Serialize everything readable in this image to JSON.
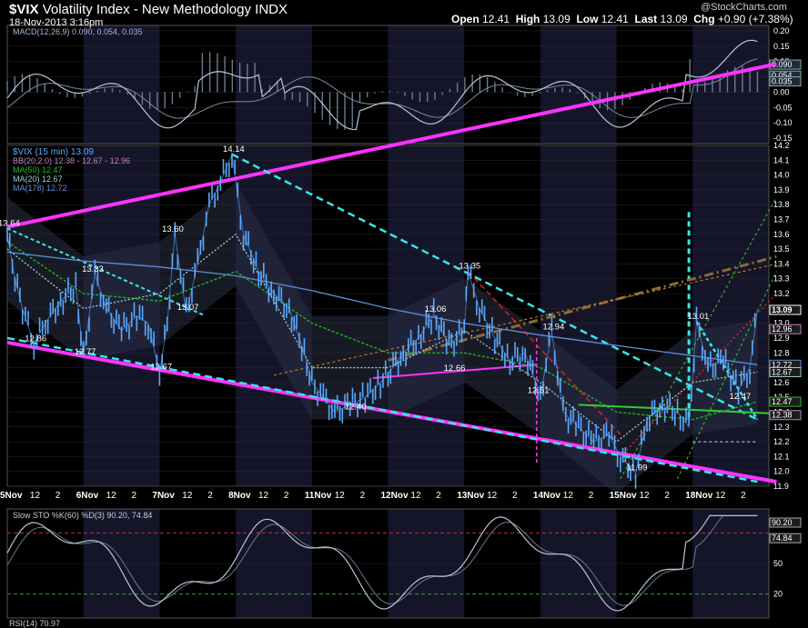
{
  "header": {
    "symbol": "$VIX",
    "name": "Volatility Index - New Methodology",
    "exchange": "INDX",
    "datetime": "18-Nov-2013 3:16pm",
    "open_label": "Open",
    "open": "12.41",
    "high_label": "High",
    "high": "13.09",
    "low_label": "Low",
    "low": "12.41",
    "last_label": "Last",
    "last": "13.09",
    "chg_label": "Chg",
    "chg": "+0.90 (+7.38%)",
    "watermark": "@StockCharts.com"
  },
  "colors": {
    "background": "#000000",
    "band": "#15152a",
    "price": "#5aa8ff",
    "magenta": "#ff33ff",
    "cyan": "#39e6e6",
    "ma50": "#1fbf1f",
    "ma20": "#9ad0d6",
    "ma178": "#5f8fd8",
    "red": "#e02020",
    "orange": "#e08a1a",
    "brown": "#8a6a3a",
    "green": "#33cc33",
    "grid": "#2a2a2a",
    "macd": "#b8c4d0",
    "signal": "#7a8aa0"
  },
  "chart_data": {
    "type": "line",
    "x": [
      "5Nov",
      "6Nov",
      "7Nov",
      "8Nov",
      "11Nov",
      "12Nov",
      "13Nov",
      "14Nov",
      "15Nov",
      "18Nov"
    ],
    "x_ticks": [
      "5Nov",
      "12",
      "2",
      "6Nov",
      "12",
      "2",
      "7Nov",
      "12",
      "2",
      "8Nov",
      "12",
      "2",
      "11Nov",
      "12",
      "2",
      "12Nov",
      "12",
      "2",
      "13Nov",
      "12",
      "2",
      "14Nov",
      "12",
      "2",
      "15Nov",
      "12",
      "2",
      "18Nov",
      "12",
      "2"
    ],
    "panels": [
      {
        "name": "MACD",
        "legend": "MACD(12,26,9) 0.090, 0.054, 0.035",
        "ylim": [
          -0.15,
          0.2
        ],
        "y_ticks": [
          "0.20",
          "0.15",
          "0.10",
          "0.05",
          "0.00",
          "-0.05",
          "-0.10",
          "-0.15"
        ],
        "last_values": [
          "0.090",
          "0.054",
          "0.035"
        ]
      },
      {
        "name": "Price",
        "legend": [
          "$VIX (15 min) 13.09",
          "BB(20,2.0) 12.38 - 12.67 - 12.96",
          "MA(50) 12.47",
          "MA(20) 12.67",
          "MA(178) 12.72"
        ],
        "ylim": [
          11.9,
          14.2
        ],
        "y_ticks": [
          "14.2",
          "14.1",
          "14.0",
          "13.9",
          "13.8",
          "13.7",
          "13.6",
          "13.5",
          "13.4",
          "13.3",
          "13.2",
          "13.1",
          "13.0",
          "12.9",
          "12.8",
          "12.7",
          "12.6",
          "12.5",
          "12.4",
          "12.3",
          "12.2",
          "12.1",
          "12.0",
          "11.9"
        ],
        "last_values": [
          "13.09",
          "12.96",
          "12.72",
          "12.67",
          "12.47",
          "12.38"
        ],
        "annotations": [
          {
            "x": 0.0,
            "y": 13.64,
            "text": "13.64"
          },
          {
            "x": 0.35,
            "y": 12.86,
            "text": "12.86"
          },
          {
            "x": 1.1,
            "y": 13.33,
            "text": "13.33"
          },
          {
            "x": 1.0,
            "y": 12.77,
            "text": "12.77"
          },
          {
            "x": 2.15,
            "y": 13.6,
            "text": "13.60"
          },
          {
            "x": 2.0,
            "y": 12.67,
            "text": "12.67"
          },
          {
            "x": 2.35,
            "y": 13.07,
            "text": "13.07"
          },
          {
            "x": 2.95,
            "y": 14.14,
            "text": "14.14"
          },
          {
            "x": 4.55,
            "y": 12.4,
            "text": "12.40"
          },
          {
            "x": 5.6,
            "y": 13.06,
            "text": "13.06"
          },
          {
            "x": 5.85,
            "y": 12.66,
            "text": "12.66"
          },
          {
            "x": 6.05,
            "y": 13.35,
            "text": "13.35"
          },
          {
            "x": 7.15,
            "y": 12.94,
            "text": "12.94"
          },
          {
            "x": 6.95,
            "y": 12.51,
            "text": "12.51"
          },
          {
            "x": 8.25,
            "y": 11.99,
            "text": "11.99"
          },
          {
            "x": 9.05,
            "y": 13.01,
            "text": "13.01"
          },
          {
            "x": 9.6,
            "y": 12.47,
            "text": "12.47"
          }
        ],
        "series": [
          {
            "name": "$VIX (15 min)",
            "x": [
              0.0,
              0.1,
              0.2,
              0.35,
              0.5,
              0.7,
              0.9,
              1.0,
              1.15,
              1.3,
              1.5,
              1.7,
              1.85,
              2.0,
              2.1,
              2.2,
              2.35,
              2.5,
              2.65,
              2.8,
              2.95,
              3.1,
              3.3,
              3.5,
              3.7,
              3.9,
              4.0,
              4.15,
              4.3,
              4.5,
              4.7,
              4.9,
              5.0,
              5.2,
              5.4,
              5.6,
              5.8,
              6.0,
              6.05,
              6.2,
              6.4,
              6.6,
              6.8,
              7.0,
              7.15,
              7.3,
              7.5,
              7.7,
              7.9,
              8.05,
              8.25,
              8.4,
              8.6,
              8.8,
              8.95,
              9.05,
              9.2,
              9.4,
              9.6,
              9.75,
              9.85
            ],
            "values": [
              13.6,
              13.3,
              13.1,
              12.86,
              13.0,
              13.15,
              13.25,
              12.77,
              13.33,
              13.1,
              12.95,
              13.05,
              13.0,
              12.67,
              13.0,
              13.6,
              13.07,
              13.4,
              13.8,
              13.95,
              14.14,
              13.6,
              13.35,
              13.2,
              13.1,
              12.8,
              12.6,
              12.5,
              12.4,
              12.45,
              12.5,
              12.6,
              12.66,
              12.8,
              12.9,
              13.06,
              12.85,
              12.95,
              13.35,
              13.1,
              12.9,
              12.75,
              12.8,
              12.51,
              12.94,
              12.4,
              12.3,
              12.2,
              12.25,
              12.1,
              11.99,
              12.35,
              12.45,
              12.4,
              12.3,
              13.01,
              12.7,
              12.75,
              12.55,
              12.7,
              13.09
            ]
          },
          {
            "name": "MA(50)",
            "x": [
              0.0,
              1.0,
              2.0,
              3.0,
              4.0,
              5.0,
              6.0,
              7.0,
              8.0,
              9.0,
              9.85
            ],
            "values": [
              13.55,
              13.2,
              13.15,
              13.35,
              13.0,
              12.8,
              12.8,
              12.7,
              12.4,
              12.35,
              12.47
            ]
          },
          {
            "name": "MA(20)",
            "x": [
              0.0,
              1.0,
              2.0,
              3.0,
              4.0,
              5.0,
              6.0,
              7.0,
              8.0,
              9.0,
              9.85
            ],
            "values": [
              13.5,
              13.1,
              13.2,
              13.6,
              12.7,
              12.7,
              12.95,
              12.6,
              12.2,
              12.6,
              12.67
            ]
          },
          {
            "name": "MA(178)",
            "x": [
              0.0,
              1.0,
              2.0,
              3.0,
              4.0,
              5.0,
              6.0,
              7.0,
              8.0,
              9.0,
              9.85
            ],
            "values": [
              13.48,
              13.42,
              13.38,
              13.32,
              13.22,
              13.1,
              13.0,
              12.92,
              12.85,
              12.78,
              12.72
            ]
          }
        ]
      },
      {
        "name": "Slow STO",
        "legend": "Slow STO %K(60) %D(3) 90.20, 74.84",
        "ylim": [
          0,
          100
        ],
        "y_ticks": [
          "50",
          "20"
        ],
        "levels": [
          80,
          20
        ],
        "last_values": [
          "90.20",
          "74.84"
        ]
      },
      {
        "name": "RSI",
        "legend": "RSI(14) 70.97"
      }
    ]
  }
}
